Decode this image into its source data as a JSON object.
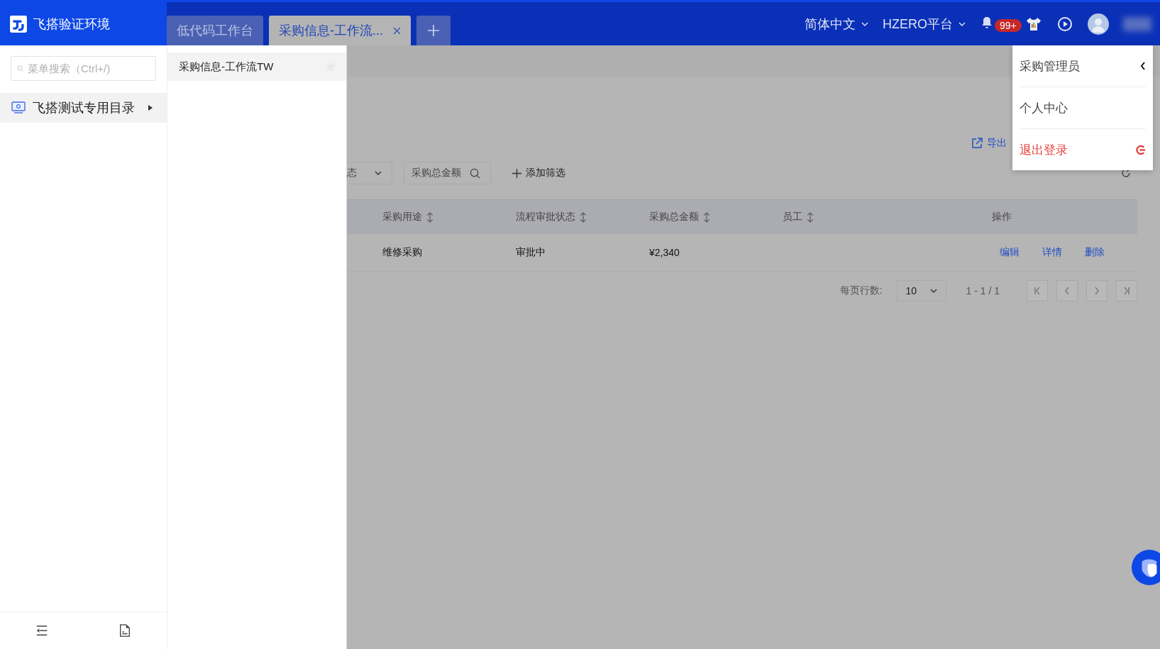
{
  "app": {
    "title": "飞搭验证环境"
  },
  "tabs": [
    {
      "label": "低代码工作台",
      "selected": false,
      "closable": false
    },
    {
      "label": "采购信息-工作流...",
      "selected": true,
      "closable": true
    }
  ],
  "header": {
    "language": "简体中文",
    "platform": "HZERO平台",
    "notification_badge": "99+"
  },
  "sidebar": {
    "search": {
      "placeholder": "菜单搜索（Ctrl+/)"
    },
    "items": [
      {
        "label": "飞搭测试专用目录",
        "selected": true
      }
    ]
  },
  "submenu": {
    "items": [
      {
        "label": "采购信息-工作流TW",
        "selected": true
      }
    ]
  },
  "toolbar": {
    "export": "导出",
    "filters": [
      {
        "kind": "select",
        "label": "态"
      },
      {
        "kind": "search",
        "label": "采购总金额"
      }
    ],
    "add_filter": "添加筛选"
  },
  "table": {
    "columns": [
      {
        "label": "采购用途",
        "sortable": true
      },
      {
        "label": "流程审批状态",
        "sortable": true
      },
      {
        "label": "采购总金额",
        "sortable": true
      },
      {
        "label": "员工",
        "sortable": true
      },
      {
        "label": "操作",
        "sortable": false
      }
    ],
    "rows": [
      {
        "cells": [
          "维修采购",
          "审批中",
          "¥2,340"
        ],
        "actions": [
          "编辑",
          "详情",
          "删除"
        ]
      }
    ]
  },
  "pagination": {
    "label": "每页行数:",
    "page_size": "10",
    "range": "1 - 1 / 1"
  },
  "user_menu": [
    {
      "label": "采购管理员",
      "kind": "role"
    },
    {
      "label": "个人中心",
      "kind": "link"
    },
    {
      "label": "退出登录",
      "kind": "logout"
    }
  ]
}
